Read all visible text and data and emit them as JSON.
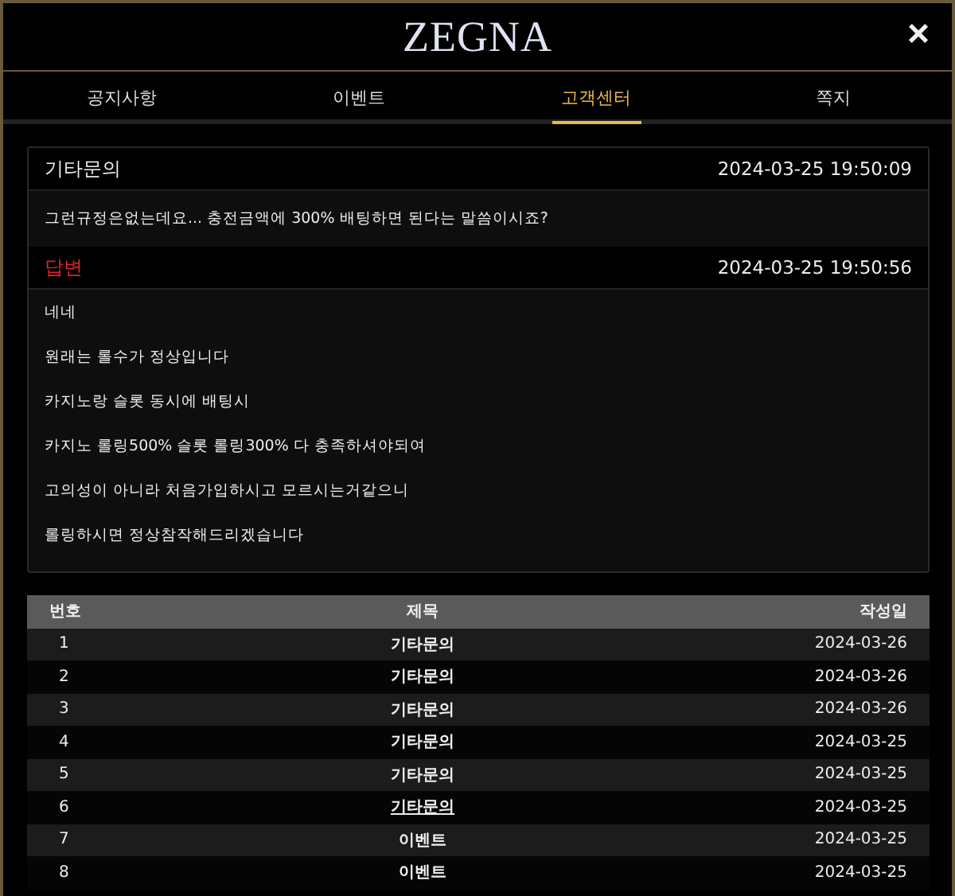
{
  "logo": "ZEGNA",
  "close": "×",
  "tabs": [
    {
      "label": "공지사항",
      "selected": false
    },
    {
      "label": "이벤트",
      "selected": false
    },
    {
      "label": "고객센터",
      "selected": true
    },
    {
      "label": "쪽지",
      "selected": false
    }
  ],
  "question": {
    "title": "기타문의",
    "time": "2024-03-25 19:50:09",
    "body": "그런규정은없는데요... 충전금액에 300% 배팅하면 된다는 말씀이시죠?"
  },
  "answer": {
    "title": "답변",
    "time": "2024-03-25 19:50:56",
    "lines": [
      "네네",
      "원래는 롤수가 정상입니다",
      "카지노랑 슬롯 동시에 배팅시",
      "카지노 롤링500% 슬롯 롤링300% 다 충족하셔야되여",
      "고의성이 아니라 처음가입하시고 모르시는거같으니",
      "롤링하시면 정상참작해드리겠습니다"
    ]
  },
  "table": {
    "columns": [
      "번호",
      "제목",
      "작성일"
    ],
    "rows": [
      {
        "number": "1",
        "title": "기타문의",
        "date": "2024-03-26",
        "hovered": false
      },
      {
        "number": "2",
        "title": "기타문의",
        "date": "2024-03-26",
        "hovered": false
      },
      {
        "number": "3",
        "title": "기타문의",
        "date": "2024-03-26",
        "hovered": false
      },
      {
        "number": "4",
        "title": "기타문의",
        "date": "2024-03-25",
        "hovered": false
      },
      {
        "number": "5",
        "title": "기타문의",
        "date": "2024-03-25",
        "hovered": false
      },
      {
        "number": "6",
        "title": "기타문의",
        "date": "2024-03-25",
        "hovered": true
      },
      {
        "number": "7",
        "title": "이벤트",
        "date": "2024-03-25",
        "hovered": false
      },
      {
        "number": "8",
        "title": "이벤트",
        "date": "2024-03-25",
        "hovered": false
      }
    ]
  }
}
